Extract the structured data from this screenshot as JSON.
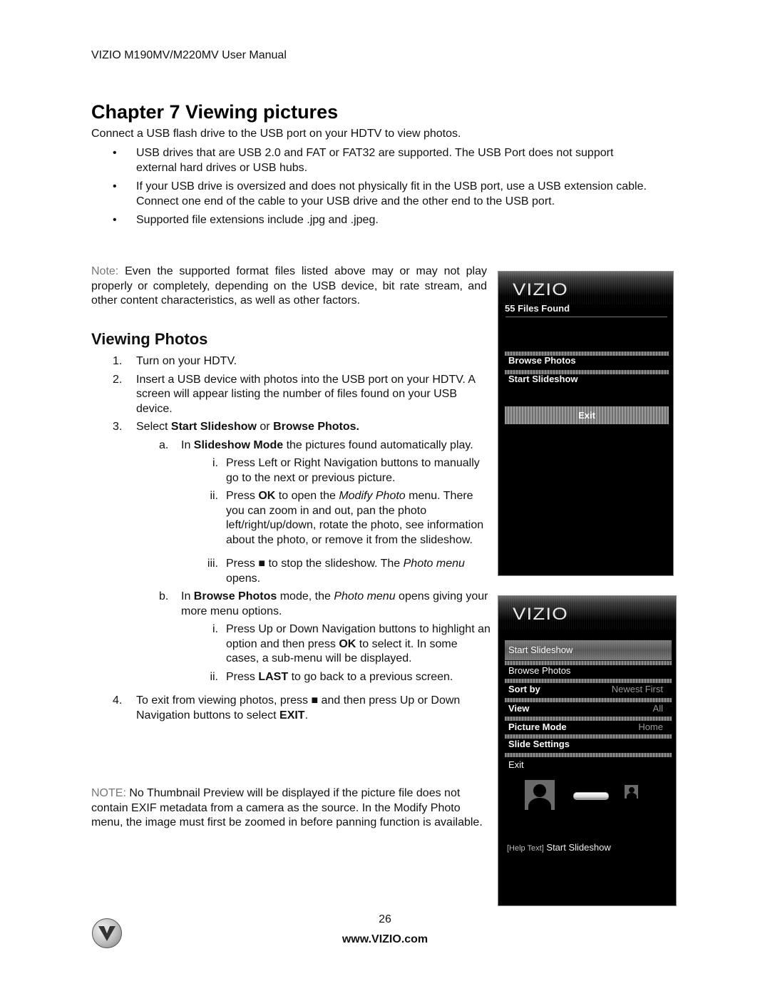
{
  "header": {
    "manual_title": "VIZIO M190MV/M220MV User Manual"
  },
  "chapter": {
    "title": "Chapter 7 Viewing pictures",
    "intro": "Connect a USB flash drive to the USB port on your HDTV to view photos.",
    "bullets": [
      "USB drives that are USB 2.0 and FAT or FAT32 are supported. The USB Port does not support external hard drives or USB hubs.",
      "If your USB drive is oversized and does not physically fit in the USB port, use a USB extension cable. Connect one end of the cable to your USB drive and the other end to the USB port.",
      "Supported file extensions include .jpg and .jpeg."
    ],
    "bullet_glyph": "•",
    "note": {
      "label": "Note:",
      "text": " Even the supported format files listed above may or may not play properly or completely, depending on the USB device, bit rate stream, and other content characteristics, as well as other factors."
    }
  },
  "section": {
    "title": "Viewing Photos",
    "steps": {
      "s1": {
        "num": "1.",
        "text": "Turn on your HDTV."
      },
      "s2": {
        "num": "2.",
        "text": "Insert a USB device with photos into the USB port on your HDTV. A screen will appear listing the number of files found on your USB device."
      },
      "s3": {
        "num": "3.",
        "pre": "Select ",
        "b1": "Start Slideshow",
        "mid": " or ",
        "b2": "Browse Photos."
      },
      "s3a": {
        "num": "a.",
        "pre": "In ",
        "b1": "Slideshow Mode",
        "post": " the pictures found automatically play."
      },
      "s3a_i": {
        "num": "i.",
        "text": "Press Left or Right Navigation buttons to manually go to the next or previous picture."
      },
      "s3a_ii": {
        "num": "ii.",
        "pre": "Press ",
        "b1": "OK",
        "mid": " to open the ",
        "i1": "Modify Photo",
        "post": " menu. There you can zoom in and out, pan the photo left/right/up/down, rotate the photo, see information about the photo, or remove it from the slideshow."
      },
      "s3a_iii": {
        "num": "iii.",
        "pre": "Press ",
        "stop": "■",
        "mid": " to stop the slideshow. The ",
        "i1": "Photo menu",
        "post": " opens."
      },
      "s3b": {
        "num": "b.",
        "pre": "In ",
        "b1": "Browse Photos",
        "mid": " mode, the ",
        "i1": "Photo menu",
        "post": " opens giving your more menu options."
      },
      "s3b_i": {
        "num": "i.",
        "pre": "Press Up or Down Navigation buttons to highlight an option and then press ",
        "b1": "OK",
        "post": " to select it. In some cases, a sub-menu will be displayed."
      },
      "s3b_ii": {
        "num": "ii.",
        "pre": "Press ",
        "b1": "LAST",
        "post": " to go back to a previous screen."
      },
      "s4": {
        "num": "4.",
        "pre": "To exit from viewing photos, press ",
        "stop": "■",
        "mid": " and then press Up or Down Navigation buttons to select ",
        "b1": "EXIT",
        "post": "."
      }
    },
    "note": {
      "label": "NOTE:",
      "text": " No Thumbnail Preview will be displayed if the picture file does not contain EXIF metadata from a camera as the source. In the Modify Photo menu, the image must first be zoomed in before panning function is available."
    }
  },
  "screen1": {
    "logo": "VIZIO",
    "files_found": "55   Files Found",
    "items": [
      "Browse Photos",
      "Start Slideshow"
    ],
    "exit": "Exit"
  },
  "screen2": {
    "logo": "VIZIO",
    "highlighted": "Start Slideshow",
    "items": [
      {
        "label": "Browse Photos",
        "value": ""
      },
      {
        "label": "Sort by",
        "value": "Newest First"
      },
      {
        "label": "View",
        "value": "All"
      },
      {
        "label": "Picture Mode",
        "value": "Home"
      },
      {
        "label": "Slide Settings",
        "value": ""
      },
      {
        "label": "Exit",
        "value": ""
      }
    ],
    "help_tag": "[Help Text]",
    "help_text": " Start Slideshow"
  },
  "footer": {
    "page_number": "26",
    "website": "www.VIZIO.com"
  }
}
